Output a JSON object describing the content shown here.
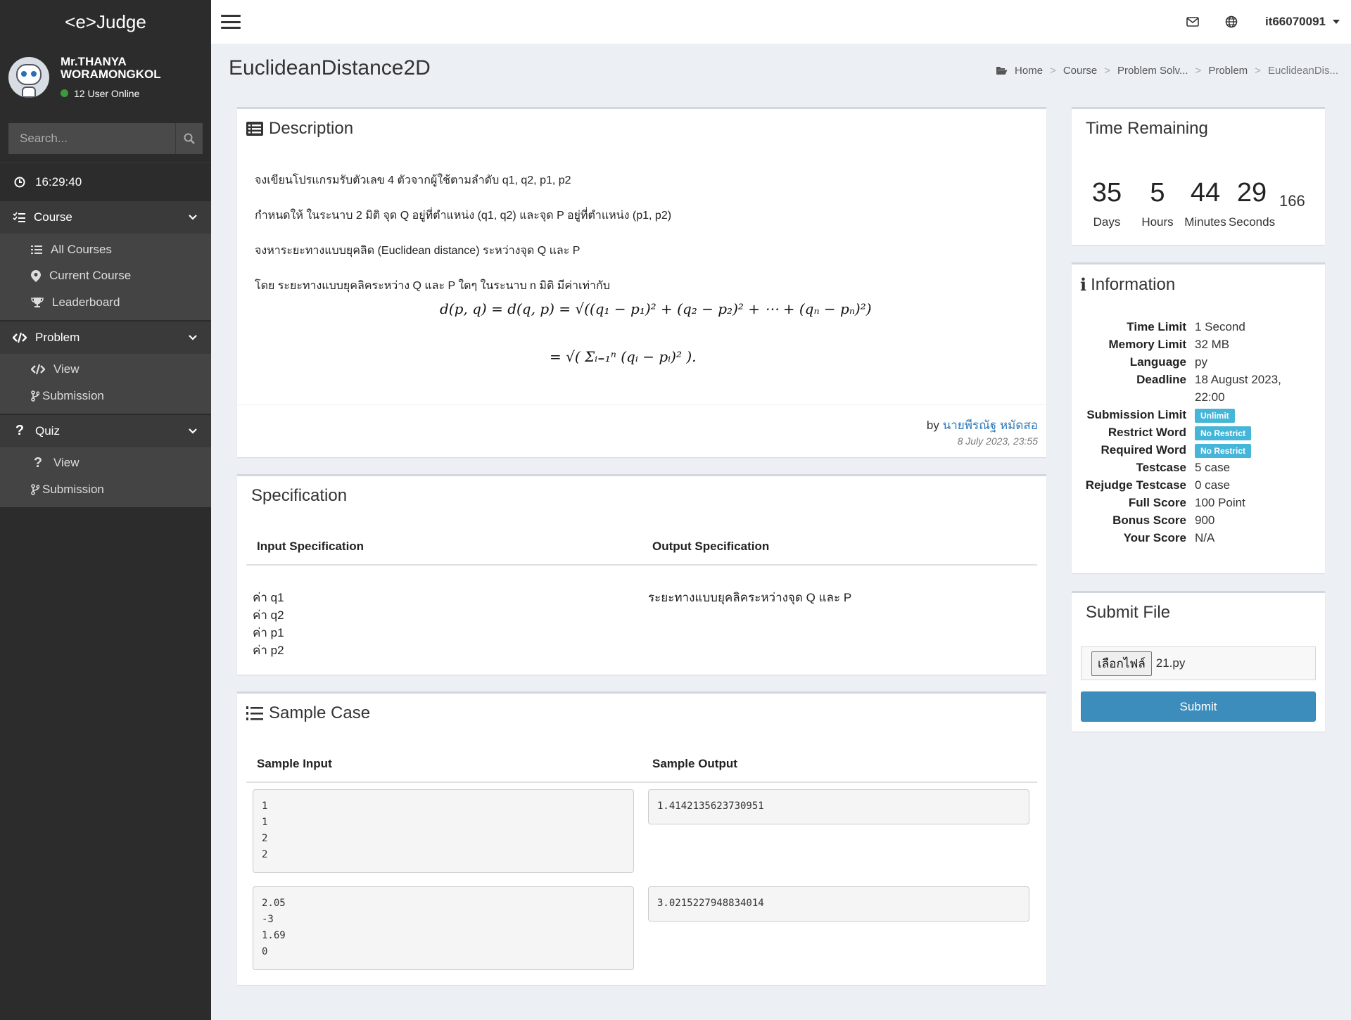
{
  "app": {
    "brand": "<e>Judge"
  },
  "user": {
    "name_line1": "Mr.THANYA",
    "name_line2": "WORAMONGKOL",
    "online": "12 User Online"
  },
  "search": {
    "placeholder": "Search..."
  },
  "clock": "16:29:40",
  "sidebar": {
    "course": {
      "label": "Course",
      "items": [
        "All Courses",
        "Current Course",
        "Leaderboard"
      ]
    },
    "problem": {
      "label": "Problem",
      "items": [
        "View",
        "Submission"
      ]
    },
    "quiz": {
      "label": "Quiz",
      "items": [
        "View",
        "Submission"
      ]
    }
  },
  "topbar": {
    "username": "it66070091"
  },
  "page": {
    "title": "EuclideanDistance2D",
    "breadcrumb": [
      "Home",
      "Course",
      "Problem Solv...",
      "Problem",
      "EuclideanDis..."
    ]
  },
  "description": {
    "title": "Description",
    "p1": "จงเขียนโปรแกรมรับตัวเลข 4 ตัวจากผู้ใช้ตามลำดับ q1, q2, p1, p2",
    "p2": "กำหนดให้ ในระนาบ 2 มิติ จุด Q อยู่ที่ตำแหน่ง (q1, q2)  และจุด P อยู่ที่ตำแหน่ง (p1, p2)",
    "p3": "จงหาระยะทางแบบยุคลิด (Euclidean distance) ระหว่างจุด Q และ P",
    "p4": "โดย ระยะทางแบบยุคลิคระหว่าง Q และ P ใดๆ ในระนาบ n มิติ มีค่าเท่ากับ",
    "formula1": "d(p, q) = d(q, p) = √((q₁ − p₁)² + (q₂ − p₂)² + ⋯ + (qₙ − pₙ)²)",
    "formula2": "= √( Σᵢ₌₁ⁿ (qᵢ − pᵢ)² ).",
    "author_prefix": "by",
    "author": "นายพีรณัฐ หมัดสอ",
    "date": "8 July 2023, 23:55"
  },
  "specification": {
    "title": "Specification",
    "input_header": "Input Specification",
    "output_header": "Output Specification",
    "inputs": [
      "ค่า q1",
      "ค่า q2",
      "ค่า p1",
      "ค่า p2"
    ],
    "output": "ระยะทางแบบยุคลิคระหว่างจุด Q และ P"
  },
  "sample": {
    "title": "Sample Case",
    "input_header": "Sample Input",
    "output_header": "Sample Output",
    "cases": [
      {
        "input": "1\n1\n2\n2",
        "output": "1.4142135623730951"
      },
      {
        "input": "2.05\n-3\n1.69\n0",
        "output": "3.0215227948834014"
      }
    ]
  },
  "time_remaining": {
    "title": "Time Remaining",
    "days": "35",
    "hours": "5",
    "minutes": "44",
    "seconds": "29",
    "ms": "166",
    "labels": [
      "Days",
      "Hours",
      "Minutes",
      "Seconds"
    ]
  },
  "information": {
    "title": "Information",
    "rows": [
      {
        "key": "Time Limit",
        "value": "1 Second"
      },
      {
        "key": "Memory Limit",
        "value": "32 MB"
      },
      {
        "key": "Language",
        "value": "py"
      },
      {
        "key": "Deadline",
        "value": "18 August 2023, 22:00"
      },
      {
        "key": "Submission Limit",
        "value": "Unlimit"
      },
      {
        "key": "Restrict Word",
        "value": "No Restrict"
      },
      {
        "key": "Required Word",
        "value": "No Restrict"
      },
      {
        "key": "Testcase",
        "value": "5 case"
      },
      {
        "key": "Rejudge Testcase",
        "value": "0 case"
      },
      {
        "key": "Full Score",
        "value": "100 Point"
      },
      {
        "key": "Bonus Score",
        "value": "900"
      },
      {
        "key": "Your Score",
        "value": "N/A"
      }
    ]
  },
  "submit": {
    "title": "Submit File",
    "choose_label": "เลือกไฟล์",
    "file_name": "21.py",
    "button": "Submit"
  },
  "colors": {
    "primary": "#3c8dbc",
    "badge": "#45b5d8",
    "sidebar": "#2c2c2c",
    "link": "#2f7ab8"
  }
}
